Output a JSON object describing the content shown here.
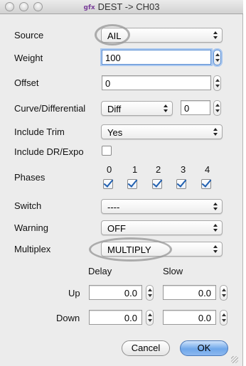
{
  "window": {
    "title": "DEST -> CH03",
    "app_icon_text": "gfx"
  },
  "source": {
    "label": "Source",
    "value": "AIL"
  },
  "weight": {
    "label": "Weight",
    "value": "100"
  },
  "offset": {
    "label": "Offset",
    "value": "0"
  },
  "curve": {
    "label": "Curve/Differential",
    "type": "Diff",
    "value": "0"
  },
  "include_trim": {
    "label": "Include Trim",
    "value": "Yes"
  },
  "include_dr_expo": {
    "label": "Include DR/Expo",
    "checked": false
  },
  "phases": {
    "label": "Phases",
    "items": [
      {
        "num": "0",
        "checked": true
      },
      {
        "num": "1",
        "checked": true
      },
      {
        "num": "2",
        "checked": true
      },
      {
        "num": "3",
        "checked": true
      },
      {
        "num": "4",
        "checked": true
      }
    ]
  },
  "switch": {
    "label": "Switch",
    "value": "----"
  },
  "warning": {
    "label": "Warning",
    "value": "OFF"
  },
  "multiplex": {
    "label": "Multiplex",
    "value": "MULTIPLY"
  },
  "timing": {
    "delay_header": "Delay",
    "slow_header": "Slow",
    "up": {
      "label": "Up",
      "delay": "0.0",
      "slow": "0.0"
    },
    "down": {
      "label": "Down",
      "delay": "0.0",
      "slow": "0.0"
    }
  },
  "buttons": {
    "cancel": "Cancel",
    "ok": "OK"
  }
}
